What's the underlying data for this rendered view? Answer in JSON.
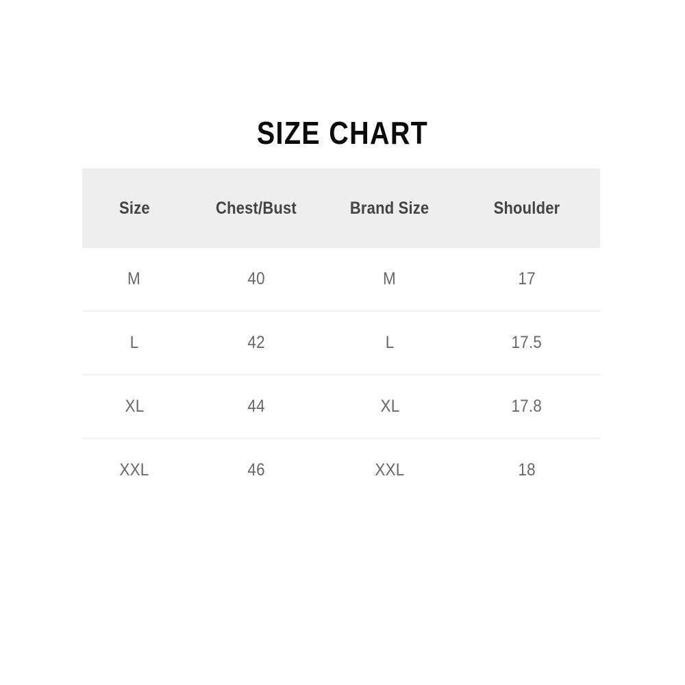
{
  "page": {
    "background_color": "#ffffff",
    "title": "SIZE CHART",
    "title_color": "#0b0b0b"
  },
  "table": {
    "header_background_color": "#eeeeee",
    "header_text_color": "#434343",
    "body_text_color": "#686868",
    "divider_color": "#f2f2f2",
    "columns": [
      {
        "key": "size",
        "label": "Size"
      },
      {
        "key": "chest_bust",
        "label": "Chest/Bust"
      },
      {
        "key": "brand_size",
        "label": "Brand Size"
      },
      {
        "key": "shoulder",
        "label": "Shoulder"
      }
    ],
    "rows": [
      {
        "size": "M",
        "chest_bust": "40",
        "brand_size": "M",
        "shoulder": "17"
      },
      {
        "size": "L",
        "chest_bust": "42",
        "brand_size": "L",
        "shoulder": "17.5"
      },
      {
        "size": "XL",
        "chest_bust": "44",
        "brand_size": "XL",
        "shoulder": "17.8"
      },
      {
        "size": "XXL",
        "chest_bust": "46",
        "brand_size": "XXL",
        "shoulder": "18"
      }
    ]
  },
  "chart_data": {
    "type": "table",
    "title": "SIZE CHART",
    "columns": [
      "Size",
      "Chest/Bust",
      "Brand Size",
      "Shoulder"
    ],
    "rows": [
      [
        "M",
        "40",
        "M",
        "17"
      ],
      [
        "L",
        "42",
        "L",
        "17.5"
      ],
      [
        "XL",
        "44",
        "XL",
        "17.8"
      ],
      [
        "XXL",
        "46",
        "XXL",
        "18"
      ]
    ],
    "xlabel": "",
    "ylabel": "",
    "legend": []
  }
}
